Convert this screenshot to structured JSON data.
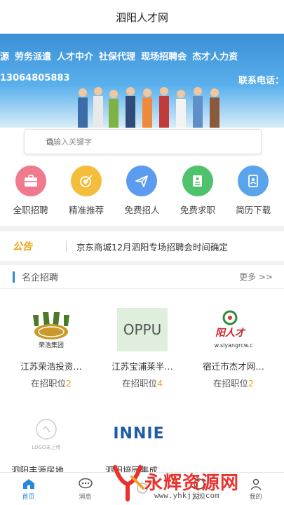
{
  "header": {
    "title": "泗阳人才网"
  },
  "banner": {
    "services": [
      "源",
      "劳务派遣",
      "人才中介",
      "社保代理",
      "现场招聘会",
      "杰才人力资"
    ],
    "phone_left": "13064805883",
    "phone_right": "联系电话："
  },
  "search": {
    "placeholder": "请输入关键字"
  },
  "quick_links": [
    {
      "label": "全职招聘",
      "icon": "briefcase-icon",
      "color": "#f07a8d"
    },
    {
      "label": "精准推荐",
      "icon": "target-icon",
      "color": "#f5bd3c"
    },
    {
      "label": "免费招人",
      "icon": "paper-plane-icon",
      "color": "#5b9cf0"
    },
    {
      "label": "免费求职",
      "icon": "resume-icon",
      "color": "#4fc36b"
    },
    {
      "label": "简历下载",
      "icon": "document-user-icon",
      "color": "#5aa4ec"
    }
  ],
  "notice": {
    "tag": "公告",
    "text": "京东商城12月泗阳专场招聘会时间确定"
  },
  "companies_section": {
    "title": "名企招聘",
    "more": "更多 >>",
    "job_prefix": "在招职位",
    "items": [
      {
        "name": "江苏荣浩投资…",
        "count": "2",
        "logo_text": "荣浩集团"
      },
      {
        "name": "江苏宝浦莱半…",
        "count": "4",
        "logo_text": "OPPU"
      },
      {
        "name": "宿迁市杰才网…",
        "count": "2",
        "logo_text": "阳人才",
        "logo_url": "w.siyangrcw.c"
      },
      {
        "name": "泗阳丰源房地…",
        "count": "",
        "logo_text": "LOGO未上传"
      },
      {
        "name": "泗阳培园集成…",
        "count": "",
        "logo_text": "INNIE"
      }
    ]
  },
  "tabbar": [
    {
      "label": "首页",
      "icon": "home-icon",
      "active": true
    },
    {
      "label": "消息",
      "icon": "chat-icon",
      "active": false
    },
    {
      "label": "",
      "icon": "center-icon",
      "active": false
    },
    {
      "label": "发现",
      "icon": "discover-icon",
      "active": false
    },
    {
      "label": "我的",
      "icon": "user-icon",
      "active": false
    }
  ],
  "watermark": {
    "text": "永辉资源网",
    "url": "www.yhkjjj.com"
  }
}
